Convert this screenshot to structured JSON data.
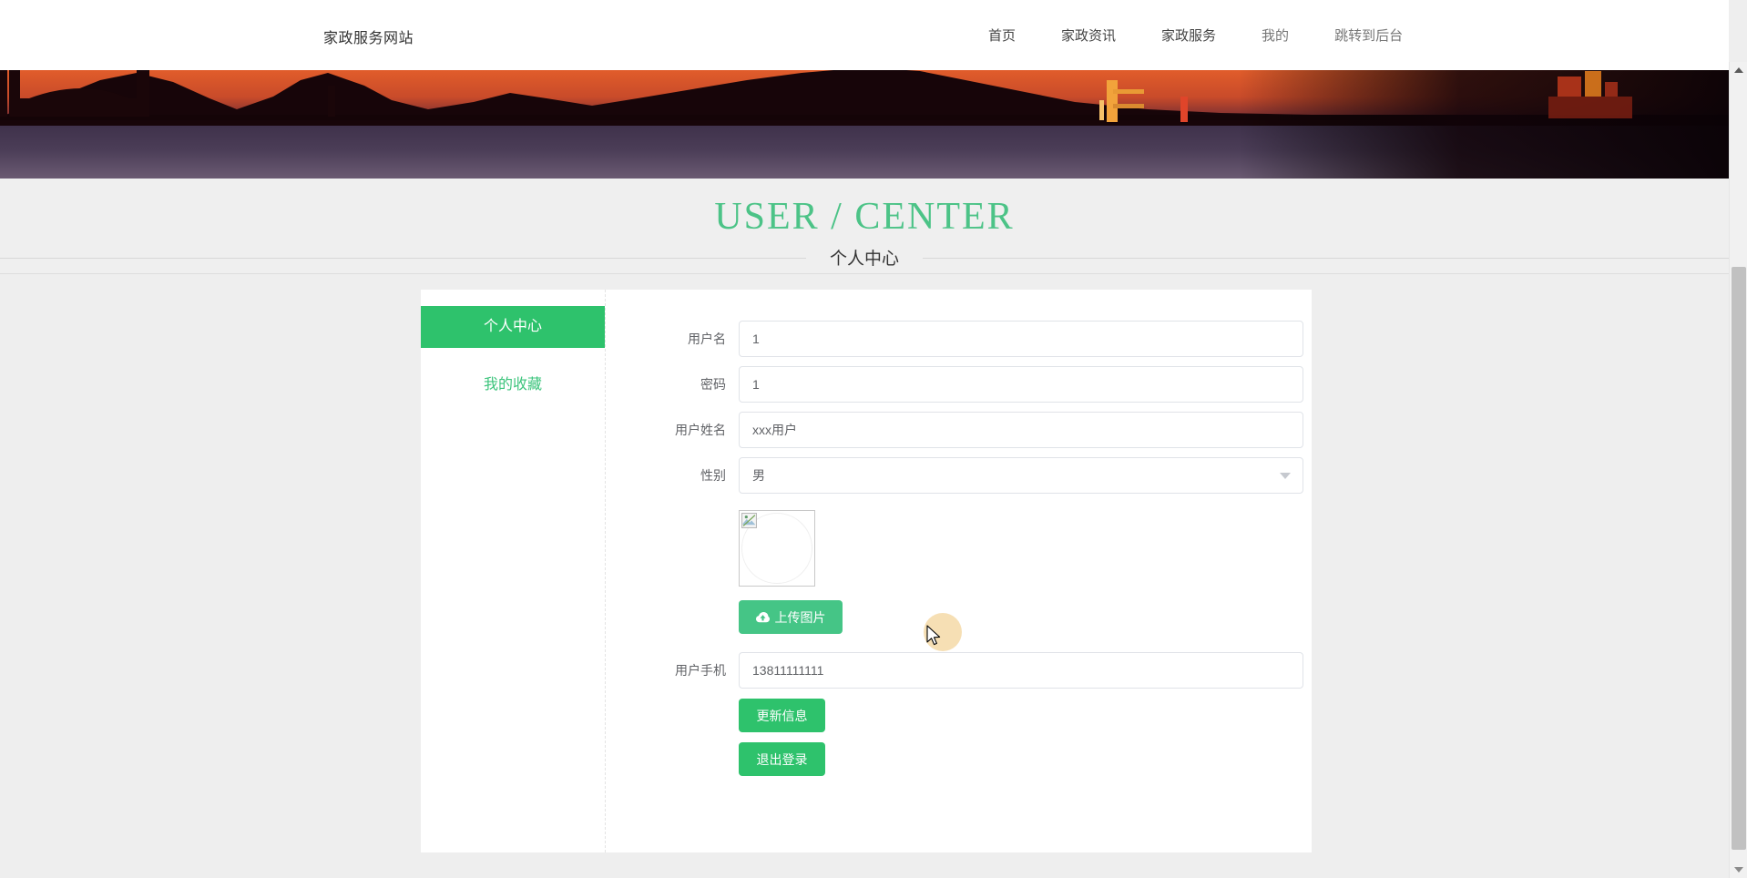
{
  "nav": {
    "brand": "家政服务网站",
    "links": [
      {
        "label": "首页",
        "muted": false
      },
      {
        "label": "家政资讯",
        "muted": false
      },
      {
        "label": "家政服务",
        "muted": false
      },
      {
        "label": "我的",
        "muted": true
      },
      {
        "label": "跳转到后台",
        "muted": true
      }
    ]
  },
  "header": {
    "title": "USER / CENTER",
    "subtitle": "个人中心",
    "title_color": "#4cc387"
  },
  "sidebar": {
    "items": [
      {
        "label": "个人中心",
        "active": true
      },
      {
        "label": "我的收藏",
        "active": false
      }
    ]
  },
  "form": {
    "fields": [
      {
        "name": "username",
        "label": "用户名",
        "value": "1",
        "type": "text"
      },
      {
        "name": "password",
        "label": "密码",
        "value": "1",
        "type": "text"
      },
      {
        "name": "fullname",
        "label": "用户姓名",
        "value": "xxx用户",
        "type": "text"
      },
      {
        "name": "gender",
        "label": "性别",
        "value": "男",
        "type": "select"
      }
    ],
    "avatar": {
      "alt": "broken-image",
      "upload_label": "上传图片"
    },
    "phone": {
      "label": "用户手机",
      "value": "13811111111"
    },
    "actions": [
      {
        "name": "update",
        "label": "更新信息"
      },
      {
        "name": "logout",
        "label": "退出登录"
      }
    ]
  },
  "theme": {
    "green": "#2ec26c",
    "green_light": "#45c586",
    "page_bg": "#efefef",
    "panel_bg": "#ffffff"
  },
  "banner": {
    "alt": "sunset-bridge-banner"
  },
  "scrollbar": {
    "up": "scroll-up-arrow",
    "down": "scroll-down-arrow"
  }
}
